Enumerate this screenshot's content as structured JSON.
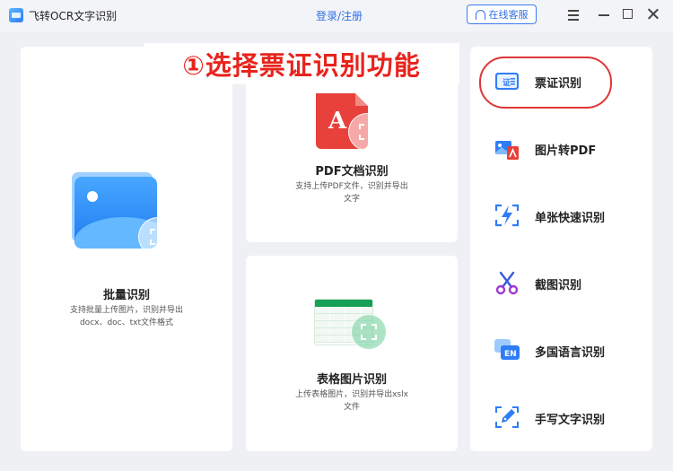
{
  "titlebar": {
    "app_title": "飞转OCR文字识别",
    "login_label": "登录/注册",
    "service_label": "在线客服"
  },
  "cards": {
    "batch": {
      "title": "批量识别",
      "desc_line1": "支持批量上传图片，识别并导出",
      "desc_line2": "docx、doc、txt文件格式"
    },
    "pdf": {
      "title": "PDF文档识别",
      "desc_line1": "支持上传PDF文件，识别并导出",
      "desc_line2": "文字",
      "icon_letter": "A"
    },
    "table": {
      "title": "表格图片识别",
      "desc_line1": "上传表格图片，识别并导出xslx",
      "desc_line2": "文件"
    }
  },
  "banner": {
    "text": "①选择票证识别功能"
  },
  "sidebar": {
    "items": [
      {
        "label": "票证识别",
        "icon": "id-card-icon",
        "icon_text": "证"
      },
      {
        "label": "图片转PDF",
        "icon": "image-to-pdf-icon"
      },
      {
        "label": "单张快速识别",
        "icon": "lightning-scan-icon"
      },
      {
        "label": "截图识别",
        "icon": "scissors-icon"
      },
      {
        "label": "多国语言识别",
        "icon": "language-icon",
        "icon_text": "EN"
      },
      {
        "label": "手写文字识别",
        "icon": "pen-icon"
      }
    ]
  },
  "colors": {
    "accent": "#2f6fe8",
    "highlight": "#e8241d",
    "pdf_red": "#e8403a",
    "table_green": "#16a056"
  }
}
